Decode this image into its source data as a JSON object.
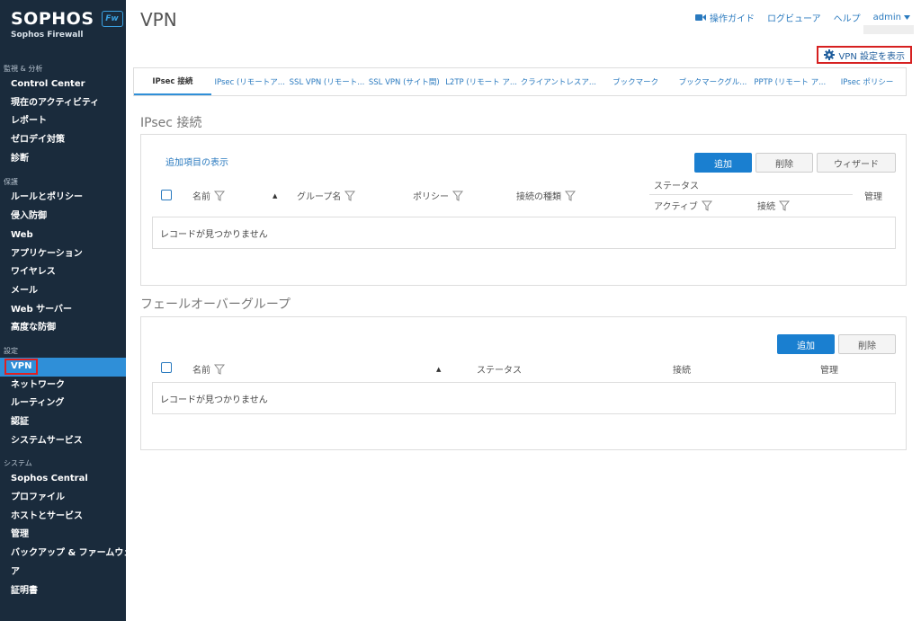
{
  "brand": {
    "name": "SOPHOS",
    "badge": "Fw",
    "subtitle": "Sophos Firewall"
  },
  "sidebar": {
    "sections": [
      {
        "title": "監視 & 分析",
        "items": [
          "Control Center",
          "現在のアクティビティ",
          "レポート",
          "ゼロデイ対策",
          "診断"
        ]
      },
      {
        "title": "保護",
        "items": [
          "ルールとポリシー",
          "侵入防御",
          "Web",
          "アプリケーション",
          "ワイヤレス",
          "メール",
          "Web サーバー",
          "高度な防御"
        ]
      },
      {
        "title": "設定",
        "items": [
          "VPN",
          "ネットワーク",
          "ルーティング",
          "認証",
          "システムサービス"
        ]
      },
      {
        "title": "システム",
        "items": [
          "Sophos Central",
          "プロファイル",
          "ホストとサービス",
          "管理",
          "バックアップ & ファームウェ",
          "ア",
          "証明書"
        ]
      }
    ],
    "active_item": "VPN"
  },
  "header": {
    "title": "VPN",
    "guide": "操作ガイド",
    "log_viewer": "ログビューア",
    "help": "ヘルプ",
    "user": "admin",
    "vpn_settings": "VPN 設定を表示"
  },
  "tabs": [
    "IPsec 接続",
    "IPsec (リモートア...",
    "SSL VPN (リモート...",
    "SSL VPN (サイト間)",
    "L2TP (リモート ア...",
    "クライアントレスア...",
    "ブックマーク",
    "ブックマークグル...",
    "PPTP (リモート ア...",
    "IPsec ポリシー"
  ],
  "ipsec": {
    "title": "IPsec 接続",
    "show_more": "追加項目の表示",
    "add": "追加",
    "delete": "削除",
    "wizard": "ウィザード",
    "col_name": "名前",
    "col_group": "グループ名",
    "col_policy": "ポリシー",
    "col_type": "接続の種類",
    "col_status": "ステータス",
    "col_active": "アクティブ",
    "col_connection": "接続",
    "col_manage": "管理",
    "empty": "レコードが見つかりません"
  },
  "failover": {
    "title": "フェールオーバーグループ",
    "add": "追加",
    "delete": "削除",
    "col_name": "名前",
    "col_status": "ステータス",
    "col_connection": "接続",
    "col_manage": "管理",
    "empty": "レコードが見つかりません"
  },
  "colors": {
    "sidebar": "#1a2b3c",
    "accent": "#1a7fd0",
    "highlight": "#d62020"
  }
}
